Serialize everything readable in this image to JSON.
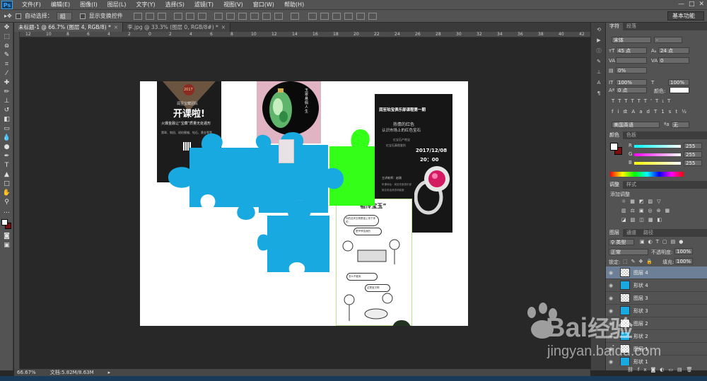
{
  "app": {
    "logo": "Ps",
    "menu": [
      "文件(F)",
      "编辑(E)",
      "图像(I)",
      "图层(L)",
      "文字(Y)",
      "选择(S)",
      "滤镜(T)",
      "视图(V)",
      "窗口(W)",
      "帮助(H)"
    ],
    "window_controls": [
      "—",
      "□",
      "✕"
    ]
  },
  "options_bar": {
    "auto_select_label": "自动选择：",
    "auto_select_value": "组",
    "show_transform_label": "显示变换控件",
    "workspace": "基本功能"
  },
  "tabs": [
    {
      "label": "未标题-1 @ 66.7% (图层 4, RGB/8) *",
      "close": "×"
    },
    {
      "label": "李.jpg @ 33.3% (图层 0, RGB/8#) *",
      "close": "×"
    }
  ],
  "ruler_ticks": [
    "12",
    "10",
    "8",
    "6",
    "4",
    "2",
    "0",
    "2",
    "4",
    "6",
    "8",
    "10",
    "12",
    "14",
    "16",
    "18",
    "20",
    "22",
    "24",
    "26",
    "28",
    "30",
    "32",
    "34",
    "36",
    "38",
    "40",
    "42"
  ],
  "status": {
    "zoom": "66.67%",
    "doc": "文档:5.82M/8.63M"
  },
  "canvas_content": {
    "poster1": {
      "logo_year": "2017",
      "club": "润至宝藏团队",
      "headline": "开课啦!",
      "subtitle": "火爆金融让“宝藏”质量无处遁形",
      "body": "翡翠、和田、琥珀蜜蜡、钻石、黄金等等"
    },
    "poster2": {
      "vertical_text": "玉翠悬佩人生"
    },
    "poster3": {
      "title": "润至珀宝俱乐部课程第一期",
      "line1": "热情的红色",
      "line2": "认识市场上的红色宝石",
      "line3": "红宝石产地宝",
      "line4": "红宝石真假鉴别",
      "date": "2017/12/08",
      "time": "20：00",
      "host": "主讲老师：赵刚",
      "footer1": "听课地址：润至珀宝俱乐部",
      "footer2": "报名电话请咨询客服"
    },
    "cartoon": {
      "title": "“祖传宝玉”",
      "bubble1": "你的这块玉佩是祖上传下来的",
      "bubble2": "是爷爷给我的",
      "bubble3": "怎么不能卖",
      "bubble4": "这是宝贝啊"
    }
  },
  "panels": {
    "char_tabs": [
      "字符",
      "段落"
    ],
    "font_family": "宋体",
    "font_style": "-",
    "size": "45 点",
    "leading": "24 点",
    "tracking_label": "VA",
    "tracking": "0",
    "scale_v": "0%",
    "scale_v2": "100%",
    "scale_h": "100%",
    "baseline": "0 点",
    "color_label": "颜色:",
    "lang": "美国英语",
    "aa": "无",
    "color_tabs": [
      "颜色",
      "色板"
    ],
    "rgb": [
      {
        "ch": "R",
        "val": "255"
      },
      {
        "ch": "G",
        "val": "255"
      },
      {
        "ch": "B",
        "val": "255"
      }
    ],
    "adjust_tabs": [
      "调整",
      "样式"
    ],
    "adjust_title": "添加调整",
    "layers_tabs": [
      "图层",
      "通道",
      "路径"
    ],
    "kind": "类型",
    "blend": "正常",
    "opacity_label": "不透明度:",
    "opacity": "100%",
    "lock_label": "锁定:",
    "fill_label": "填充:",
    "fill": "100%",
    "layers": [
      {
        "name": "图层 4",
        "selected": true
      },
      {
        "name": "形状 4",
        "selected": false
      },
      {
        "name": "图层 3",
        "selected": false
      },
      {
        "name": "形状 3",
        "selected": false
      },
      {
        "name": "图层 2",
        "selected": false
      },
      {
        "name": "形状 2",
        "selected": false
      },
      {
        "name": "图层 1",
        "selected": false
      },
      {
        "name": "形状 1",
        "selected": false
      }
    ]
  },
  "watermark": {
    "brand": "Bai",
    "brand2": "经验",
    "url": "jingyan.baidu.com"
  },
  "colors": {
    "puzzle_blue": "#19a9e1",
    "puzzle_green": "#33ff19",
    "ps_blue": "#31a8ff",
    "bg": "#282828",
    "panel": "#535353"
  }
}
